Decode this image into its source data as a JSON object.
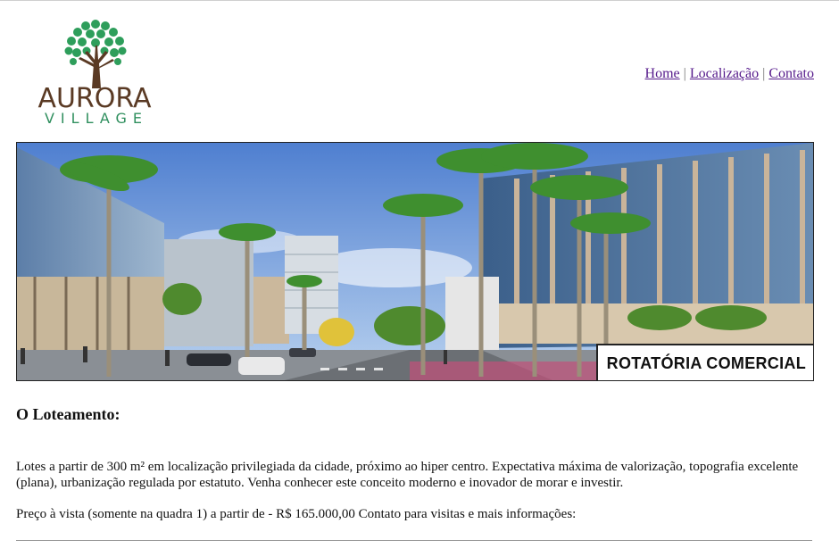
{
  "logo": {
    "title": "AURORA",
    "subtitle": "VILLAGE",
    "colors": {
      "leaves": "#2e9e5b",
      "trunk": "#5a3a24"
    }
  },
  "nav": {
    "home": "Home",
    "location": "Localização",
    "contact": "Contato",
    "separator": "|"
  },
  "banner": {
    "caption": "ROTATÓRIA COMERCIAL"
  },
  "content": {
    "heading": "O Loteamento:",
    "description": "Lotes a partir de 300 m² em localização privilegiada da cidade, próximo ao hiper centro. Expectativa máxima de valorização, topografia excelente (plana), urbanização regulada por estatuto. Venha conhecer este conceito moderno e inovador de morar e investir.",
    "price": "Preço à vista (somente na quadra 1) a partir de - R$ 165.000,00 Contato para visitas e mais informações:"
  }
}
